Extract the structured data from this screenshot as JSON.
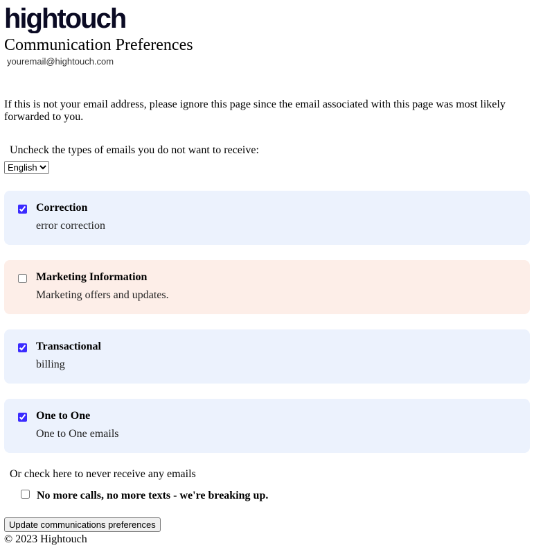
{
  "page_title": "Communication Preferences",
  "email": "youremail@hightouch.com",
  "notice": "If this is not your email address, please ignore this page since the email associated with this page was most likely forwarded to you.",
  "instructions": "Uncheck the types of emails you do not want to receive:",
  "language_selected": "English",
  "categories": [
    {
      "title": "Correction",
      "description": "error correction",
      "checked": true
    },
    {
      "title": "Marketing Information",
      "description": "Marketing offers and updates.",
      "checked": false
    },
    {
      "title": "Transactional",
      "description": "billing",
      "checked": true
    },
    {
      "title": "One to One",
      "description": "One to One emails",
      "checked": true
    }
  ],
  "global_opt_out_intro": "Or check here to never receive any emails",
  "global_opt_out_label": "No more calls, no more texts - we're breaking up.",
  "global_opt_out_checked": false,
  "update_button": "Update communications preferences",
  "footer": "© 2023 Hightouch"
}
